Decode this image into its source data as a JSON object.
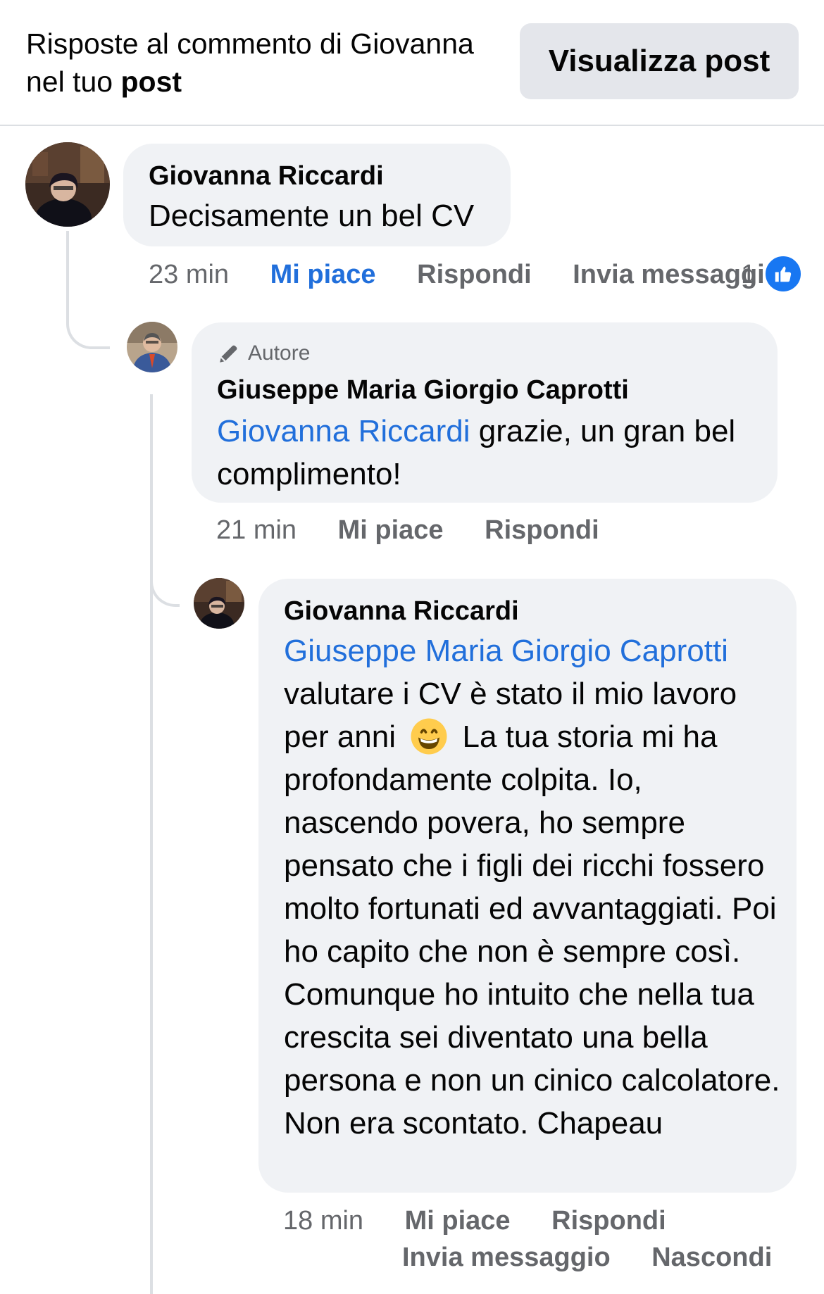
{
  "header": {
    "title_prefix": "Risposte al commento di Giovanna",
    "title_line2_prefix": "nel tuo ",
    "title_line2_bold": "post",
    "view_post_button": "Visualizza post"
  },
  "comments": [
    {
      "author": "Giovanna Riccardi",
      "text": "Decisamente un bel CV",
      "time": "23 min",
      "actions": [
        "Mi piace",
        "Rispondi",
        "Invia messaggio"
      ],
      "liked": true,
      "reaction_count": "1"
    },
    {
      "badge": "Autore",
      "author": "Giuseppe Maria Giorgio Caprotti",
      "mention": "Giovanna Riccardi",
      "text": " grazie, un gran bel complimento!",
      "time": "21 min",
      "actions": [
        "Mi piace",
        "Rispondi"
      ]
    },
    {
      "author": "Giovanna Riccardi",
      "mention": "Giuseppe Maria Giorgio Caprotti",
      "text_before_emoji": "valutare i CV è stato il mio lavoro per anni",
      "emoji": "😄",
      "text_after_emoji": "La tua storia mi ha profondamente colpita. Io, nascendo povera, ho sempre pensato che i figli dei ricchi fossero molto fortunati ed avvantaggiati. Poi ho capito che non è sempre così. Comunque ho intuito che nella tua crescita sei diventato una bella persona e non un cinico calcolatore. Non era scontato. Chapeau",
      "time": "18 min",
      "actions": [
        "Mi piace",
        "Rispondi",
        "Invia messaggio",
        "Nascondi"
      ]
    }
  ],
  "colors": {
    "link": "#216fdb",
    "bubble": "#f0f2f5",
    "meta": "#65676b",
    "like_badge": "#1877f2",
    "button_bg": "#e4e6eb"
  },
  "icons": [
    "pencil-icon",
    "thumbs-up-icon",
    "grinning-emoji-icon"
  ]
}
